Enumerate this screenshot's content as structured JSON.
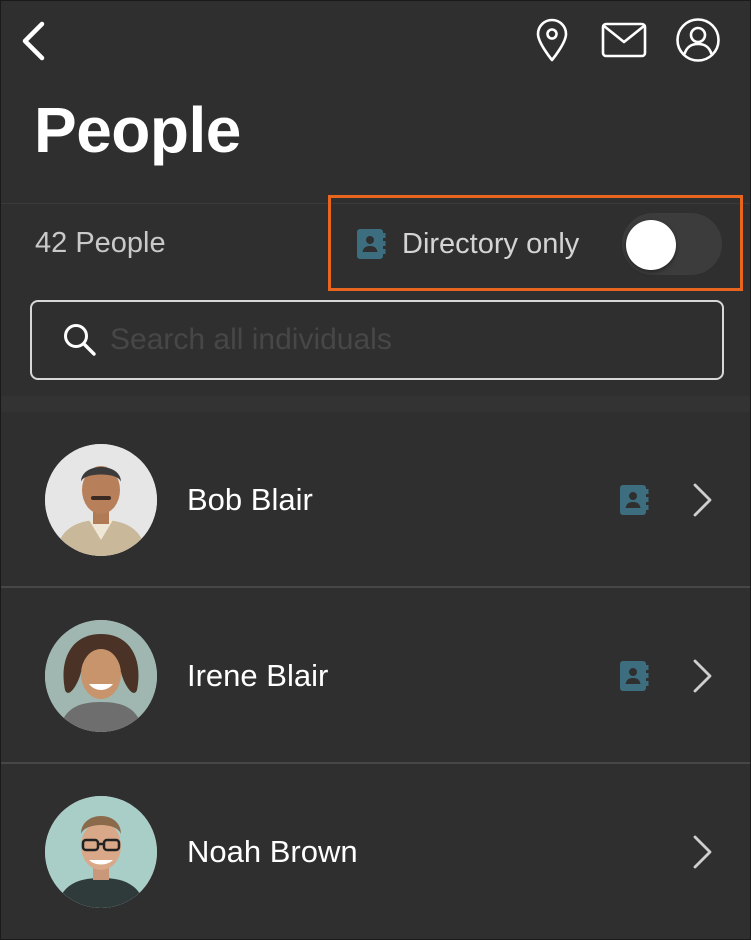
{
  "header": {
    "title": "People",
    "icons": [
      "back-chevron-icon",
      "location-pin-icon",
      "mail-icon",
      "account-icon"
    ]
  },
  "summary": {
    "count_label": "42 People"
  },
  "filter": {
    "label": "Directory only",
    "toggle_on": false,
    "icon": "directory-book-icon",
    "highlight_color": "#e8651f"
  },
  "search": {
    "placeholder": "Search all individuals",
    "value": ""
  },
  "people": [
    {
      "name": "Bob Blair",
      "in_directory": true
    },
    {
      "name": "Irene Blair",
      "in_directory": true
    },
    {
      "name": "Noah Brown",
      "in_directory": false
    }
  ],
  "colors": {
    "background": "#2f2f2f",
    "accent_directory_icon": "#3d6e80",
    "text_primary": "#ffffff",
    "text_secondary": "#c9c9c9"
  }
}
